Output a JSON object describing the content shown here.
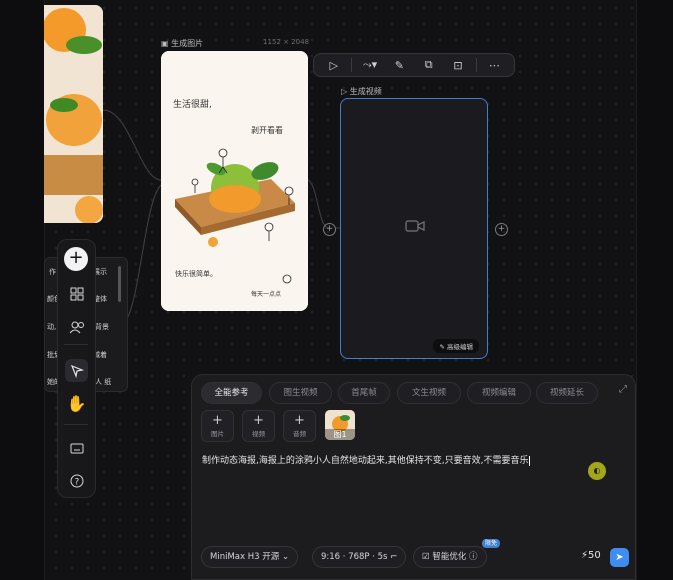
{
  "canvas": {
    "image_node": {
      "title": "生成图片",
      "size": "1152 × 2048"
    },
    "video_node": {
      "title": "生成视频",
      "badge": "高级编辑"
    },
    "image_handwriting": {
      "line1": "生活很甜,",
      "line2": "剥开看看",
      "line3": "快乐很简单。",
      "line4": "每天一点点"
    }
  },
  "toolbar": {
    "items": [
      "play-icon",
      "connect-icon",
      "brush-icon",
      "crop-icon",
      "scan-icon",
      "more-icon"
    ]
  },
  "left_panel": {
    "items": [
      {
        "left": "作",
        "right": "展示"
      },
      {
        "left": "颜色",
        "right": "整体"
      },
      {
        "left": "动,",
        "right": "背景"
      },
      {
        "left": "批划",
        "right": "减着"
      },
      {
        "left": "她的",
        "right": "人 纸"
      }
    ]
  },
  "prompt": {
    "tabs": [
      "全能参考",
      "图生视频",
      "首尾帧",
      "文生视频",
      "视频编辑",
      "视频延长"
    ],
    "active_tab": "全能参考",
    "uploads": [
      {
        "label": "图片"
      },
      {
        "label": "视频"
      },
      {
        "label": "音频"
      }
    ],
    "reference_label": "图1",
    "text": "制作动态海报,海报上的涂鸦小人自然地动起来,其他保持不变,只要音效,不需要音乐",
    "model": "MiniMax H3 开源",
    "settings": "9:16 · 768P · 5s",
    "smart_optimize": "智能优化",
    "new_badge": "限免",
    "credits": "50"
  }
}
